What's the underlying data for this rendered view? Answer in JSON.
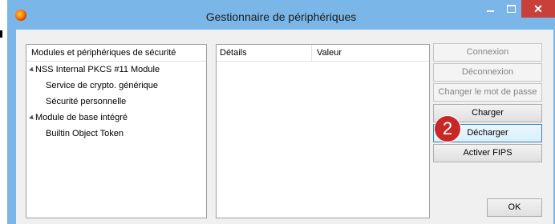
{
  "window": {
    "title": "Gestionnaire de périphériques"
  },
  "tree": {
    "header": "Modules et périphériques de sécurité",
    "items": [
      {
        "label": "NSS Internal PKCS #11 Module",
        "level": 0
      },
      {
        "label": "Service de crypto. générique",
        "level": 1
      },
      {
        "label": "Sécurité personnelle",
        "level": 1
      },
      {
        "label": "Module de base intégré",
        "level": 0
      },
      {
        "label": "Builtin Object Token",
        "level": 1
      }
    ]
  },
  "details": {
    "col_details": "Détails",
    "col_value": "Valeur"
  },
  "buttons": {
    "connexion": "Connexion",
    "deconnexion": "Déconnexion",
    "changer_mdp": "Changer le mot de passe",
    "charger": "Charger",
    "decharger": "Décharger",
    "fips": "Activer FIPS",
    "ok": "OK"
  },
  "badge": {
    "number": "2"
  },
  "colors": {
    "frame": "#7ab6e8",
    "close": "#c9403b",
    "badge": "#c62828"
  }
}
